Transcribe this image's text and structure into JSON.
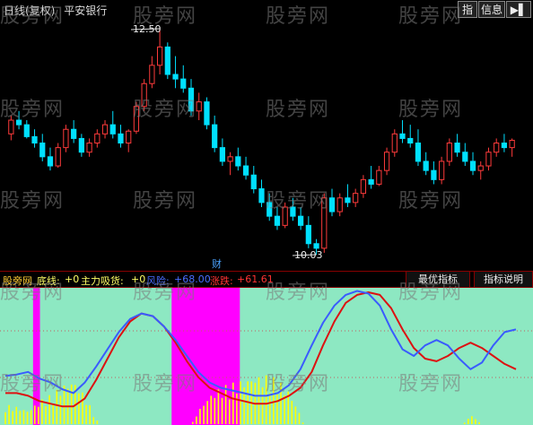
{
  "header": {
    "period": "日线(复权)",
    "stock_name": "平安银行"
  },
  "toolbar": {
    "index_label": "指",
    "info_label": "信息",
    "arrow_icon": "play-icon"
  },
  "price": {
    "high_label": "12.50",
    "low_label": "10.03",
    "fin_marker": "财"
  },
  "indicator_header": {
    "name": "股旁网",
    "items": [
      {
        "label": "底线:",
        "value": "+0",
        "color": "#ffff66"
      },
      {
        "label": "主力吸货:",
        "value": "+0",
        "color": "#ffff66"
      },
      {
        "label": "风险:",
        "value": "+68.00",
        "color": "#4a6dff"
      },
      {
        "label": "涨跌:",
        "value": "+61.61",
        "color": "#ff3333"
      }
    ],
    "best_button": "最优指标",
    "help_button": "指标说明"
  },
  "watermark": "股旁网",
  "colors": {
    "up": "#ff3b3b",
    "down": "#00e0ff",
    "panel_bg": "#8de8c2",
    "magenta": "#ff00ff",
    "yellow": "#ffff00",
    "risk_line": "#3a5cff",
    "change_line": "#dd1111"
  },
  "chart_data": [
    {
      "type": "candlestick",
      "title": "",
      "annotations": [
        "12.50",
        "10.03",
        "财"
      ],
      "marks": {
        "high": 12.5,
        "low": 10.03
      },
      "candles_ohlc_approx": [
        [
          11.35,
          11.55,
          11.28,
          11.5
        ],
        [
          11.5,
          11.6,
          11.4,
          11.45
        ],
        [
          11.45,
          11.5,
          11.3,
          11.32
        ],
        [
          11.32,
          11.4,
          11.2,
          11.25
        ],
        [
          11.25,
          11.35,
          11.05,
          11.1
        ],
        [
          11.1,
          11.2,
          10.95,
          11.0
        ],
        [
          11.0,
          11.25,
          10.98,
          11.2
        ],
        [
          11.2,
          11.45,
          11.15,
          11.4
        ],
        [
          11.4,
          11.5,
          11.25,
          11.3
        ],
        [
          11.3,
          11.35,
          11.1,
          11.15
        ],
        [
          11.15,
          11.3,
          11.1,
          11.25
        ],
        [
          11.25,
          11.4,
          11.2,
          11.35
        ],
        [
          11.35,
          11.5,
          11.3,
          11.45
        ],
        [
          11.45,
          11.6,
          11.3,
          11.35
        ],
        [
          11.35,
          11.45,
          11.2,
          11.25
        ],
        [
          11.25,
          11.4,
          11.15,
          11.38
        ],
        [
          11.38,
          11.7,
          11.35,
          11.65
        ],
        [
          11.65,
          11.95,
          11.6,
          11.9
        ],
        [
          11.9,
          12.2,
          11.85,
          12.1
        ],
        [
          12.1,
          12.5,
          12.0,
          12.3
        ],
        [
          12.3,
          12.35,
          11.95,
          12.0
        ],
        [
          12.0,
          12.2,
          11.85,
          11.95
        ],
        [
          11.95,
          12.1,
          11.8,
          11.85
        ],
        [
          11.85,
          11.95,
          11.55,
          11.6
        ],
        [
          11.6,
          11.8,
          11.5,
          11.7
        ],
        [
          11.7,
          11.75,
          11.4,
          11.45
        ],
        [
          11.45,
          11.55,
          11.15,
          11.2
        ],
        [
          11.2,
          11.3,
          11.0,
          11.05
        ],
        [
          11.05,
          11.15,
          10.9,
          11.1
        ],
        [
          11.1,
          11.2,
          10.95,
          11.0
        ],
        [
          11.0,
          11.1,
          10.85,
          10.9
        ],
        [
          10.9,
          11.0,
          10.7,
          10.75
        ],
        [
          10.75,
          10.85,
          10.55,
          10.6
        ],
        [
          10.6,
          10.7,
          10.4,
          10.45
        ],
        [
          10.45,
          10.55,
          10.3,
          10.35
        ],
        [
          10.35,
          10.6,
          10.32,
          10.55
        ],
        [
          10.55,
          10.65,
          10.4,
          10.45
        ],
        [
          10.45,
          10.55,
          10.3,
          10.35
        ],
        [
          10.35,
          10.45,
          10.1,
          10.15
        ],
        [
          10.15,
          10.2,
          10.03,
          10.1
        ],
        [
          10.1,
          10.7,
          10.05,
          10.65
        ],
        [
          10.65,
          10.75,
          10.45,
          10.5
        ],
        [
          10.5,
          10.7,
          10.45,
          10.65
        ],
        [
          10.65,
          10.8,
          10.55,
          10.6
        ],
        [
          10.6,
          10.75,
          10.55,
          10.7
        ],
        [
          10.7,
          10.9,
          10.65,
          10.85
        ],
        [
          10.85,
          11.0,
          10.75,
          10.8
        ],
        [
          10.8,
          11.0,
          10.78,
          10.95
        ],
        [
          10.95,
          11.2,
          10.9,
          11.15
        ],
        [
          11.15,
          11.4,
          11.1,
          11.35
        ],
        [
          11.35,
          11.5,
          11.25,
          11.3
        ],
        [
          11.3,
          11.45,
          11.2,
          11.25
        ],
        [
          11.25,
          11.4,
          11.0,
          11.05
        ],
        [
          11.05,
          11.15,
          10.9,
          10.95
        ],
        [
          10.95,
          11.05,
          10.8,
          10.85
        ],
        [
          10.85,
          11.1,
          10.8,
          11.05
        ],
        [
          11.05,
          11.3,
          11.0,
          11.25
        ],
        [
          11.25,
          11.35,
          11.1,
          11.15
        ],
        [
          11.15,
          11.25,
          11.0,
          11.05
        ],
        [
          11.05,
          11.15,
          10.9,
          10.95
        ],
        [
          10.95,
          11.05,
          10.85,
          11.0
        ],
        [
          11.0,
          11.2,
          10.95,
          11.15
        ],
        [
          11.15,
          11.3,
          11.1,
          11.25
        ],
        [
          11.25,
          11.35,
          11.15,
          11.2
        ],
        [
          11.2,
          11.3,
          11.1,
          11.28
        ]
      ]
    },
    {
      "type": "line",
      "title": "",
      "ylim": [
        0,
        100
      ],
      "series": [
        {
          "name": "风险",
          "values": [
            35,
            36,
            38,
            33,
            30,
            25,
            22,
            30,
            42,
            55,
            68,
            78,
            82,
            80,
            72,
            62,
            50,
            38,
            30,
            26,
            24,
            22,
            20,
            20,
            22,
            28,
            40,
            58,
            75,
            88,
            96,
            99,
            97,
            88,
            70,
            55,
            50,
            58,
            62,
            58,
            48,
            40,
            45,
            58,
            68,
            70
          ]
        },
        {
          "name": "涨跌",
          "values": [
            22,
            22,
            20,
            16,
            14,
            12,
            12,
            18,
            32,
            48,
            64,
            76,
            82,
            80,
            72,
            60,
            46,
            34,
            26,
            22,
            18,
            16,
            14,
            14,
            16,
            20,
            26,
            38,
            58,
            76,
            90,
            96,
            98,
            96,
            86,
            70,
            56,
            48,
            46,
            50,
            56,
            60,
            56,
            50,
            44,
            40
          ]
        }
      ],
      "magenta_zones": [
        [
          0.062,
          0.075
        ],
        [
          0.322,
          0.45
        ]
      ]
    }
  ]
}
